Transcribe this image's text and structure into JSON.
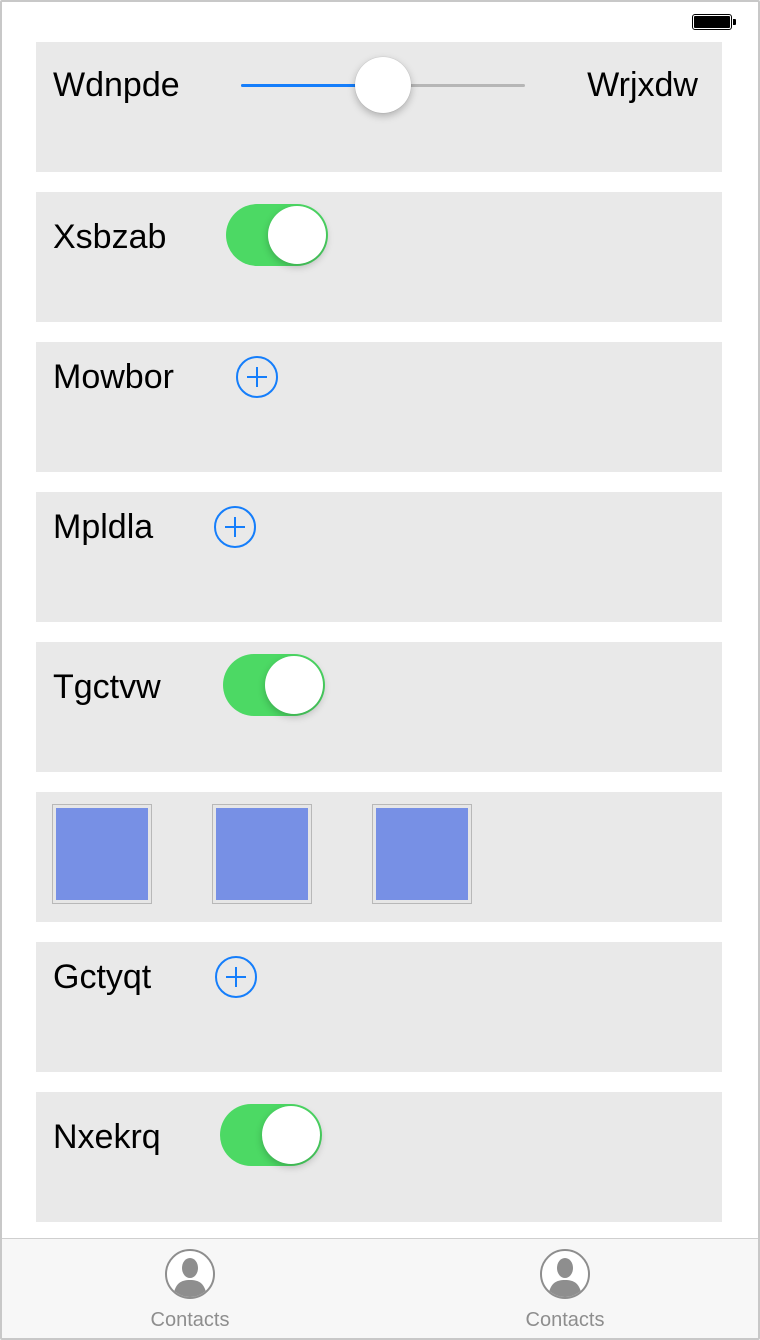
{
  "status_bar": {
    "battery_icon": "battery-full-icon"
  },
  "rows": {
    "slider_row": {
      "min_label": "Wdnpde",
      "max_label": "Wrjxdw",
      "value": 0.5,
      "track_color": "#157efb"
    },
    "toggle_row_1": {
      "label": "Xsbzab",
      "on": true
    },
    "add_row_1": {
      "label": "Mowbor"
    },
    "add_row_2": {
      "label": "Mpldla"
    },
    "toggle_row_2": {
      "label": "Tgctvw",
      "on": true
    },
    "tiles": {
      "count": 3,
      "color": "#7790e5"
    },
    "add_row_3": {
      "label": "Gctyqt"
    },
    "toggle_row_3": {
      "label": "Nxekrq",
      "on": true
    }
  },
  "colors": {
    "toggle_on": "#4cd964",
    "accent": "#157efb",
    "panel_bg": "#e9e9e9"
  },
  "tabbar": {
    "tabs": [
      {
        "label": "Contacts",
        "icon": "contacts-icon"
      },
      {
        "label": "Contacts",
        "icon": "contacts-icon"
      }
    ]
  }
}
